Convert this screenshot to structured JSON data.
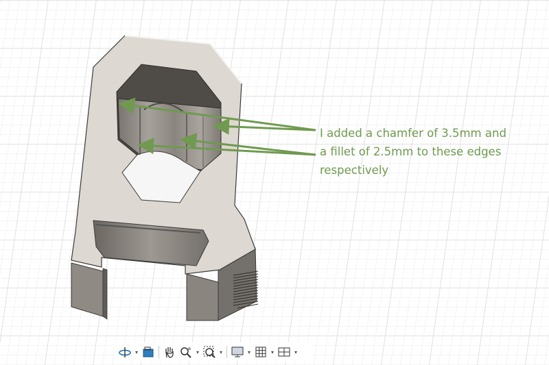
{
  "annotation": {
    "lines": [
      "I added a chamfer of 3.5mm and",
      "a fillet of 2.5mm to these edges",
      "respectively"
    ],
    "color": "#6f9a4f"
  },
  "colors": {
    "background": "#ffffff",
    "grid_minor": "#e6e6e6",
    "grid_major": "#cfcfcf",
    "part_face": "#ddd8d1",
    "part_side": "#8f8a84",
    "part_dark": "#6e6a65",
    "edge": "#3a3a3a"
  },
  "toolbar": {
    "buttons": [
      {
        "icon": "orbit-icon"
      },
      {
        "icon": "look-at-icon"
      },
      {
        "icon": "pan-hand-icon"
      },
      {
        "icon": "zoom-icon"
      },
      {
        "icon": "fit-window-icon"
      },
      {
        "icon": "display-settings-icon"
      },
      {
        "icon": "grid-snaps-icon"
      },
      {
        "icon": "viewports-icon"
      }
    ],
    "caret": "▾"
  }
}
